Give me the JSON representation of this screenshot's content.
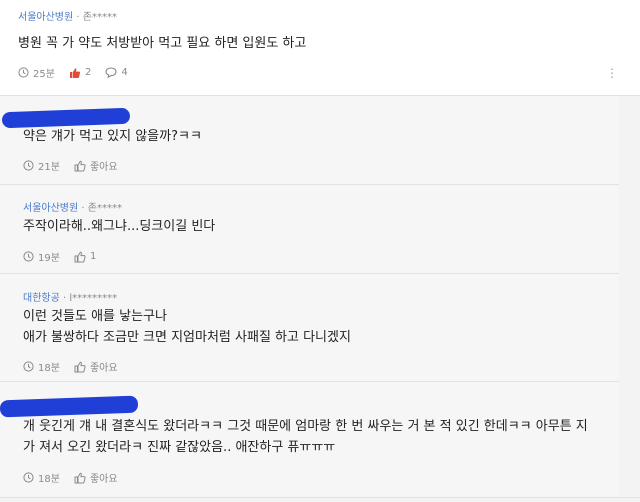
{
  "main": {
    "company": "서울아산병원",
    "author": "· 존*****",
    "text": "병원 꼭 가 약도 처방받아 먹고 필요 하면 입원도 하고",
    "time": "25분",
    "likes": "2",
    "comments": "4",
    "more": "⋮"
  },
  "replies": [
    {
      "text": "약은 걔가 먹고 있지 않을까?ㅋㅋ",
      "time": "21분",
      "like": "좋아요"
    },
    {
      "company": "서울아산병원",
      "author": "· 존*****",
      "text": "주작이라해..왜그냐...딩크이길 빈다",
      "time": "19분",
      "like": "1"
    },
    {
      "company": "대한항공",
      "author": "· l*********",
      "lines": [
        "이런 것들도 애를 낳는구나",
        "애가 불쌍하다 조금만 크면 지엄마처럼 사패질 하고 다니겠지"
      ],
      "time": "18분",
      "like": "좋아요"
    },
    {
      "lines": [
        "개 웃긴게 걔 내 결혼식도 왔더라ㅋㅋ 그것 때문에 엄마랑 한 번 싸우는 거 본 적 있긴 한데ㅋㅋ 아무튼 지",
        "가 져서 오긴 왔더라ㅋ 진짜 같잖았음.. 애잔하구 퓨ㅠㅠㅠ"
      ],
      "time": "18분",
      "like": "좋아요"
    }
  ]
}
